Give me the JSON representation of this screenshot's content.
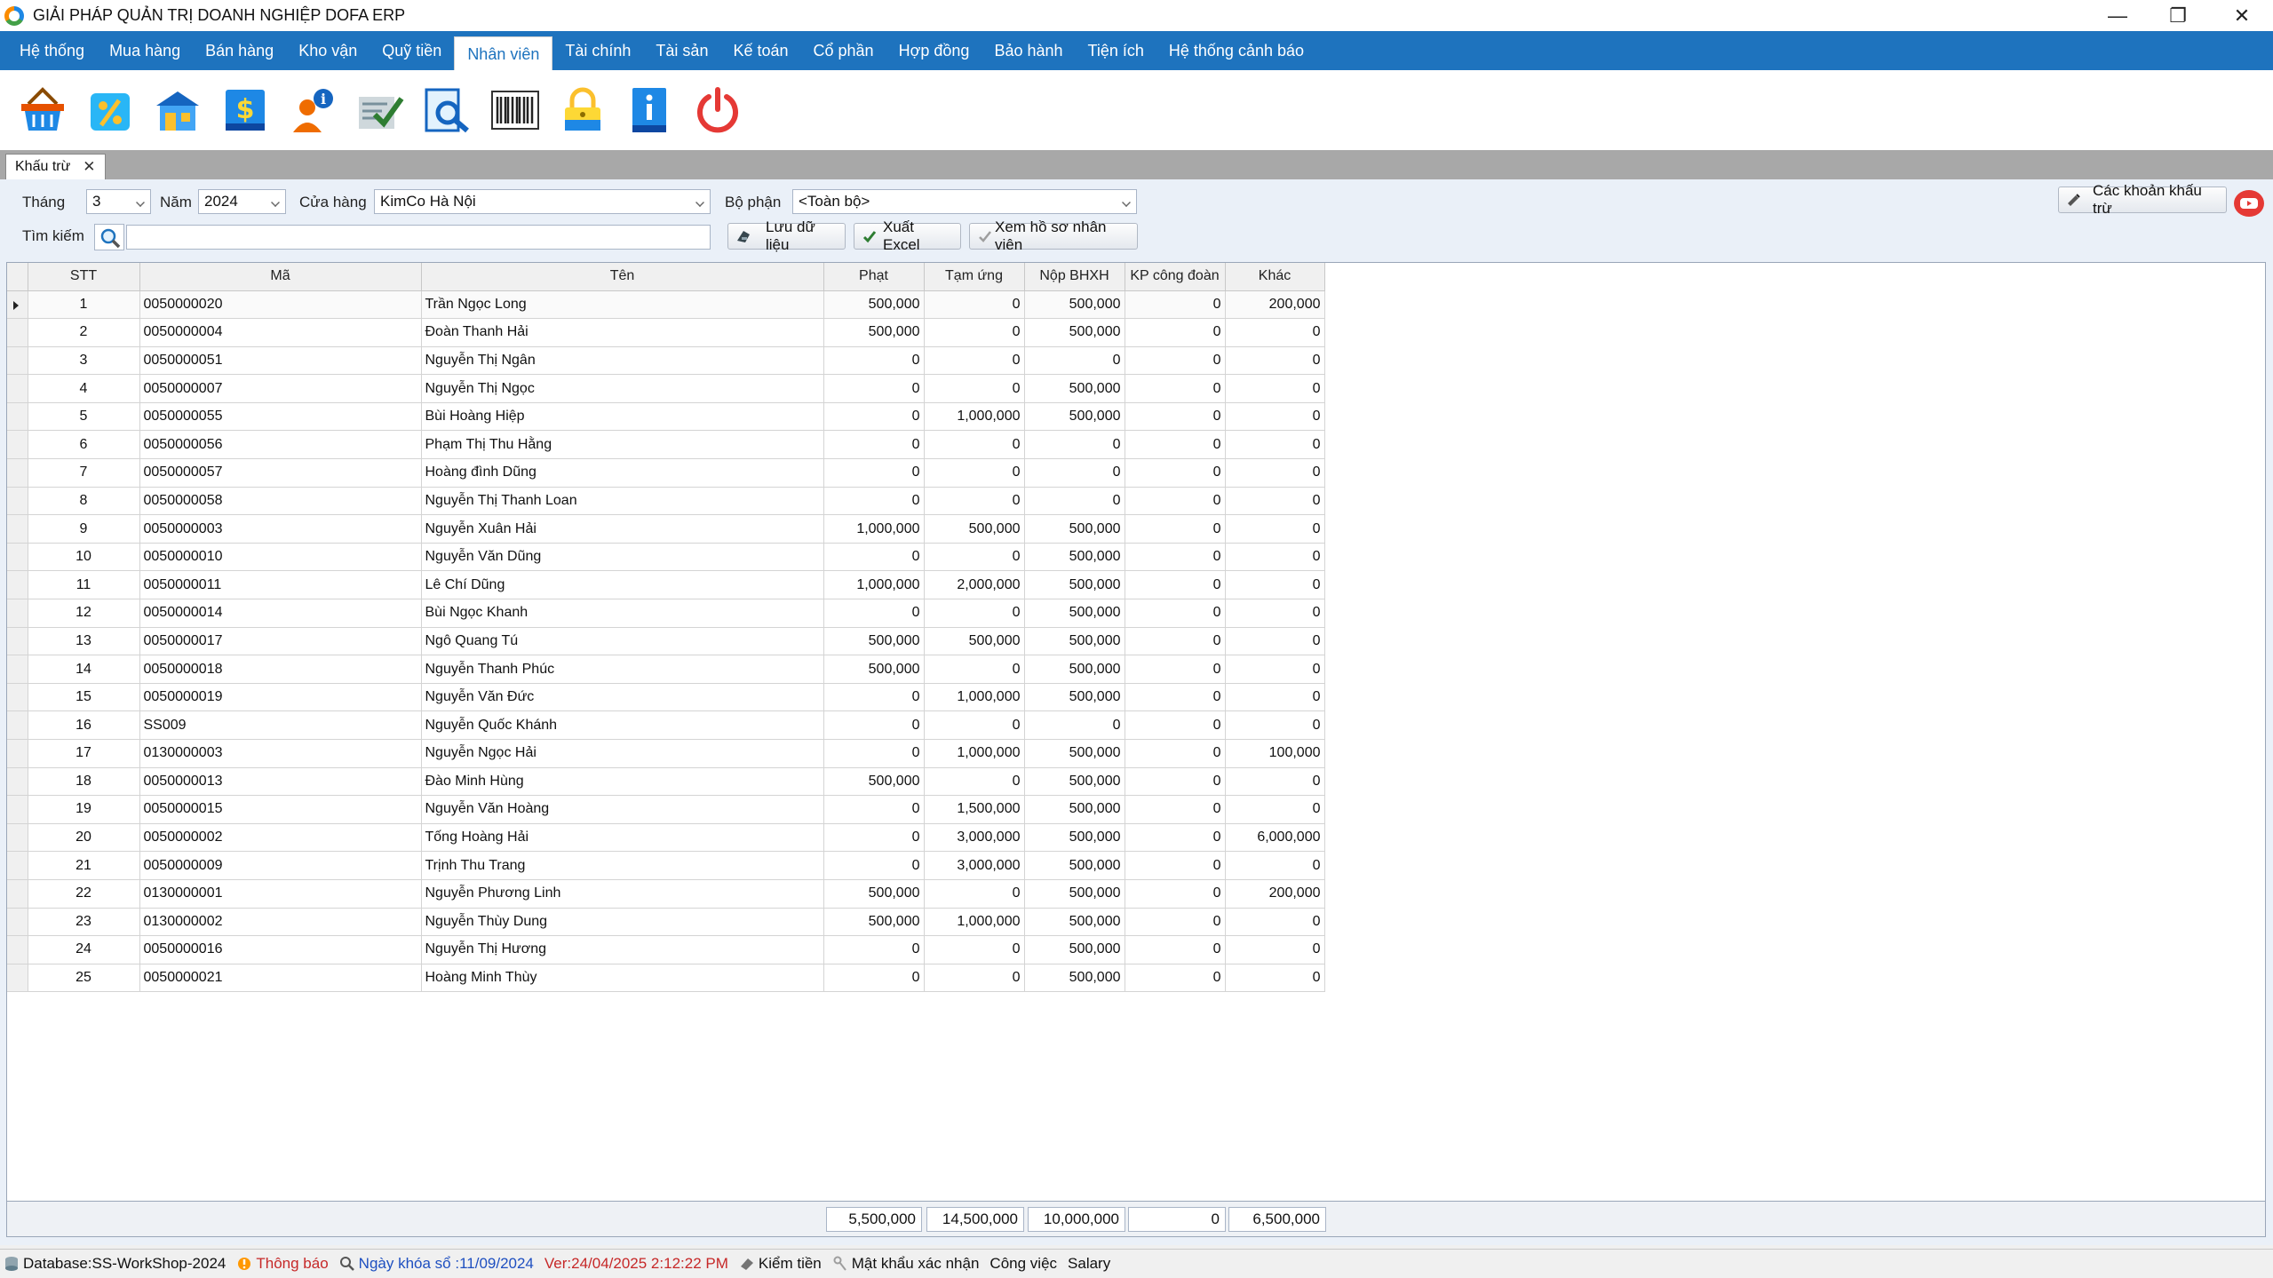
{
  "window": {
    "title": "GIẢI PHÁP QUẢN TRỊ DOANH NGHIỆP DOFA ERP"
  },
  "menu": [
    {
      "label": "Hệ thống",
      "active": false
    },
    {
      "label": "Mua hàng",
      "active": false
    },
    {
      "label": "Bán hàng",
      "active": false
    },
    {
      "label": "Kho vận",
      "active": false
    },
    {
      "label": "Quỹ tiền",
      "active": false
    },
    {
      "label": "Nhân viên",
      "active": true
    },
    {
      "label": "Tài chính",
      "active": false
    },
    {
      "label": "Tài sản",
      "active": false
    },
    {
      "label": "Kế toán",
      "active": false
    },
    {
      "label": "Cổ phần",
      "active": false
    },
    {
      "label": "Hợp đồng",
      "active": false
    },
    {
      "label": "Bảo hành",
      "active": false
    },
    {
      "label": "Tiện ích",
      "active": false
    },
    {
      "label": "Hệ thống cảnh báo",
      "active": false
    }
  ],
  "toolbar_icons": [
    "basket-icon",
    "percent-tag-icon",
    "store-icon",
    "money-icon",
    "user-info-icon",
    "checklist-icon",
    "search-document-icon",
    "barcode-icon",
    "lock-icon",
    "info-book-icon",
    "power-icon"
  ],
  "tab": {
    "label": "Khấu trừ"
  },
  "filters": {
    "thang_label": "Tháng",
    "thang_value": "3",
    "nam_label": "Năm",
    "nam_value": "2024",
    "cuahang_label": "Cửa hàng",
    "cuahang_value": "KimCo Hà Nội",
    "bophan_label": "Bộ phận",
    "bophan_value": "<Toàn bộ>",
    "timkiem_label": "Tìm kiếm",
    "timkiem_value": ""
  },
  "buttons": {
    "save": "Lưu dữ liệu",
    "excel": "Xuất Excel",
    "profile": "Xem hồ sơ nhân viên",
    "deductions": "Các khoản khấu trừ"
  },
  "grid": {
    "columns": [
      "STT",
      "Mã",
      "Tên",
      "Phạt",
      "Tạm ứng",
      "Nộp BHXH",
      "KP công đoàn",
      "Khác"
    ],
    "rows": [
      [
        "1",
        "0050000020",
        "Trần Ngọc Long",
        "500,000",
        "0",
        "500,000",
        "0",
        "200,000"
      ],
      [
        "2",
        "0050000004",
        "Đoàn Thanh Hải",
        "500,000",
        "0",
        "500,000",
        "0",
        "0"
      ],
      [
        "3",
        "0050000051",
        "Nguyễn Thị Ngân",
        "0",
        "0",
        "0",
        "0",
        "0"
      ],
      [
        "4",
        "0050000007",
        "Nguyễn Thị Ngọc",
        "0",
        "0",
        "500,000",
        "0",
        "0"
      ],
      [
        "5",
        "0050000055",
        "Bùi Hoàng Hiệp",
        "0",
        "1,000,000",
        "500,000",
        "0",
        "0"
      ],
      [
        "6",
        "0050000056",
        "Phạm Thị Thu Hằng",
        "0",
        "0",
        "0",
        "0",
        "0"
      ],
      [
        "7",
        "0050000057",
        "Hoàng đình Dũng",
        "0",
        "0",
        "0",
        "0",
        "0"
      ],
      [
        "8",
        "0050000058",
        "Nguyễn Thị Thanh Loan",
        "0",
        "0",
        "0",
        "0",
        "0"
      ],
      [
        "9",
        "0050000003",
        "Nguyễn Xuân Hải",
        "1,000,000",
        "500,000",
        "500,000",
        "0",
        "0"
      ],
      [
        "10",
        "0050000010",
        "Nguyễn Văn Dũng",
        "0",
        "0",
        "500,000",
        "0",
        "0"
      ],
      [
        "11",
        "0050000011",
        "Lê Chí Dũng",
        "1,000,000",
        "2,000,000",
        "500,000",
        "0",
        "0"
      ],
      [
        "12",
        "0050000014",
        "Bùi Ngọc Khanh",
        "0",
        "0",
        "500,000",
        "0",
        "0"
      ],
      [
        "13",
        "0050000017",
        "Ngô Quang Tú",
        "500,000",
        "500,000",
        "500,000",
        "0",
        "0"
      ],
      [
        "14",
        "0050000018",
        "Nguyễn Thanh Phúc",
        "500,000",
        "0",
        "500,000",
        "0",
        "0"
      ],
      [
        "15",
        "0050000019",
        "Nguyễn Văn Đức",
        "0",
        "1,000,000",
        "500,000",
        "0",
        "0"
      ],
      [
        "16",
        "SS009",
        "Nguyễn Quốc Khánh",
        "0",
        "0",
        "0",
        "0",
        "0"
      ],
      [
        "17",
        "0130000003",
        "Nguyễn Ngọc Hải",
        "0",
        "1,000,000",
        "500,000",
        "0",
        "100,000"
      ],
      [
        "18",
        "0050000013",
        "Đào Minh Hùng",
        "500,000",
        "0",
        "500,000",
        "0",
        "0"
      ],
      [
        "19",
        "0050000015",
        "Nguyễn Văn Hoàng",
        "0",
        "1,500,000",
        "500,000",
        "0",
        "0"
      ],
      [
        "20",
        "0050000002",
        "Tống Hoàng Hải",
        "0",
        "3,000,000",
        "500,000",
        "0",
        "6,000,000"
      ],
      [
        "21",
        "0050000009",
        "Trịnh Thu Trang",
        "0",
        "3,000,000",
        "500,000",
        "0",
        "0"
      ],
      [
        "22",
        "0130000001",
        "Nguyễn Phương Linh",
        "500,000",
        "0",
        "500,000",
        "0",
        "200,000"
      ],
      [
        "23",
        "0130000002",
        "Nguyễn Thùy Dung",
        "500,000",
        "1,000,000",
        "500,000",
        "0",
        "0"
      ],
      [
        "24",
        "0050000016",
        "Nguyễn Thị Hương",
        "0",
        "0",
        "500,000",
        "0",
        "0"
      ],
      [
        "25",
        "0050000021",
        "Hoàng Minh Thùy",
        "0",
        "0",
        "500,000",
        "0",
        "0"
      ]
    ],
    "selected_row": 0
  },
  "totals": {
    "phat": "5,500,000",
    "tamung": "14,500,000",
    "bhxh": "10,000,000",
    "kpcd": "0",
    "khac": "6,500,000"
  },
  "status": {
    "database": "Database:SS-WorkShop-2024",
    "thongbao": "Thông báo",
    "ngaykhoaso": "Ngày khóa sổ :11/09/2024",
    "version": "Ver:24/04/2025 2:12:22 PM",
    "kiemtien": "Kiểm tiền",
    "matkhau": "Mật khẩu xác nhận",
    "congviec": "Công việc",
    "salary": "Salary"
  },
  "colors": {
    "menu_bg": "#1e73be",
    "panel_bg": "#eaf0f8",
    "status_red": "#c62828",
    "status_blue": "#1e4fc0"
  }
}
